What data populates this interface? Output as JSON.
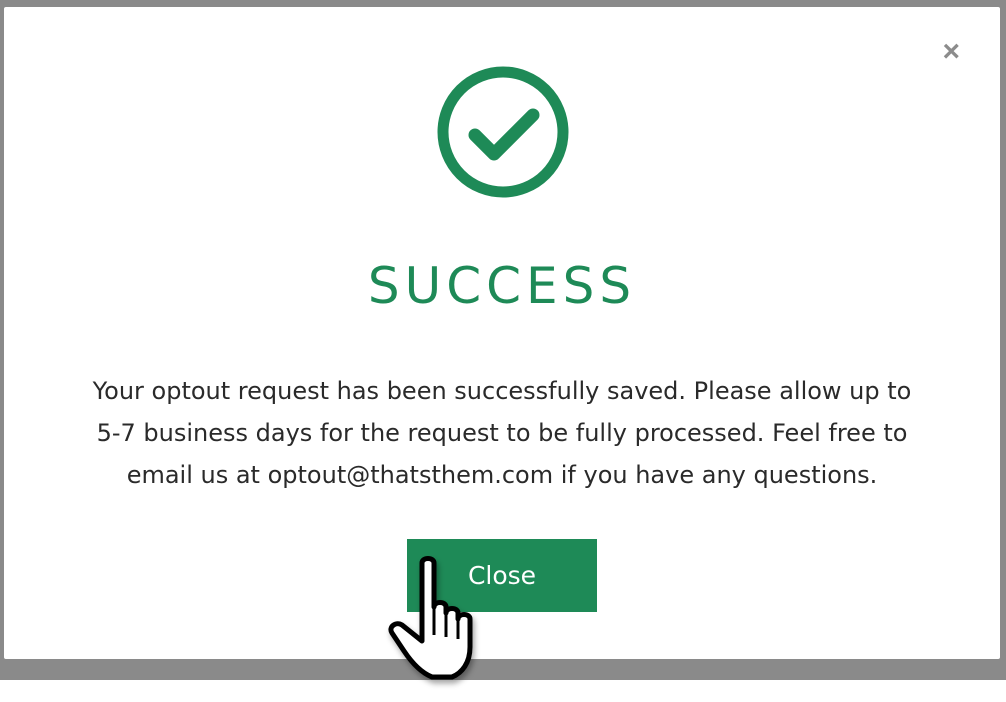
{
  "dialog": {
    "title": "SUCCESS",
    "message": "Your optout request has been successfully saved. Please allow up to 5-7 business days for the request to be fully processed. Feel free to email us at optout@thatsthem.com if you have any questions.",
    "close_button_label": "Close",
    "close_icon": "×",
    "status_icon": "check-circle-icon"
  },
  "colors": {
    "accent": "#1e8a57",
    "backdrop": "#8a8a8a",
    "text": "#2a2a2a",
    "close_icon": "#8c8c8c"
  },
  "cursor": {
    "type": "hand-pointer"
  }
}
